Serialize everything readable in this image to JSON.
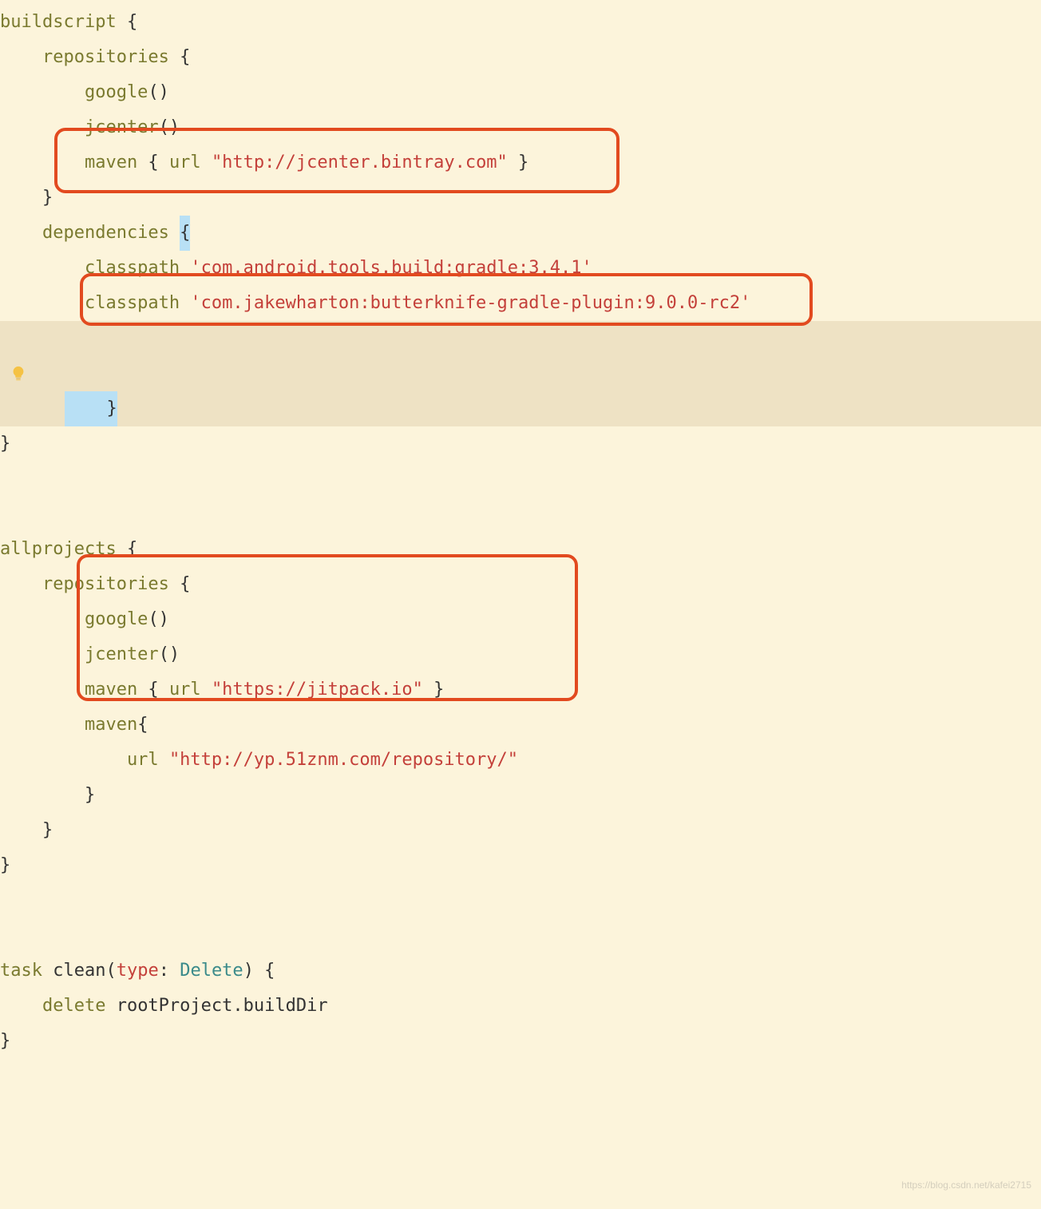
{
  "code": {
    "l1_buildscript": "buildscript",
    "l1_b": " {",
    "l2_repositories": "    repositories",
    "l2_b": " {",
    "l3_google": "        google",
    "l3_p": "()",
    "l4_jcenter": "        jcenter",
    "l4_p": "()",
    "l5_maven": "        maven",
    "l5_b1": " { ",
    "l5_url": "url",
    "l5_sp": " ",
    "l5_str": "\"http://jcenter.bintray.com\"",
    "l5_b2": " }",
    "l6": "    }",
    "l7_dependencies": "    dependencies",
    "l7_sp": " ",
    "l7_b": "{",
    "l8_classpath": "        classpath",
    "l8_sp": " ",
    "l8_str": "'com.android.tools.build:gradle:3.4.1'",
    "l9_classpath": "        classpath",
    "l9_sp": " ",
    "l9_str": "'com.jakewharton:butterknife-gradle-plugin:9.0.0-rc2'",
    "l10": "    }",
    "l11": "}",
    "l12": "",
    "l13": "",
    "l14_allprojects": "allprojects",
    "l14_b": " {",
    "l15_repositories": "    repositories",
    "l15_b": " {",
    "l16_google": "        google",
    "l16_p": "()",
    "l17_jcenter": "        jcenter",
    "l17_p": "()",
    "l18_maven": "        maven",
    "l18_b1": " { ",
    "l18_url": "url",
    "l18_sp": " ",
    "l18_str": "\"https://jitpack.io\"",
    "l18_b2": " }",
    "l19_maven": "        maven",
    "l19_b": "{",
    "l20_url": "            url",
    "l20_sp": " ",
    "l20_str": "\"http://yp.51znm.com/repository/\"",
    "l21": "        }",
    "l22": "    }",
    "l23": "}",
    "l24": "",
    "l25": "",
    "l26_task": "task",
    "l26_clean": " clean",
    "l26_p1": "(",
    "l26_type": "type",
    "l26_colon": ":",
    "l26_sp": " ",
    "l26_delete": "Delete",
    "l26_p2": ")",
    "l26_b": " {",
    "l27_delete": "    delete",
    "l27_var": " rootProject.buildDir",
    "l28": "}"
  },
  "watermark": "https://blog.csdn.net/kafei2715",
  "highlights": {
    "box1_desc": "maven jcenter.bintray.com line",
    "box2_desc": "butterknife classpath line",
    "box3_desc": "jitpack and yp.51znm maven block"
  }
}
